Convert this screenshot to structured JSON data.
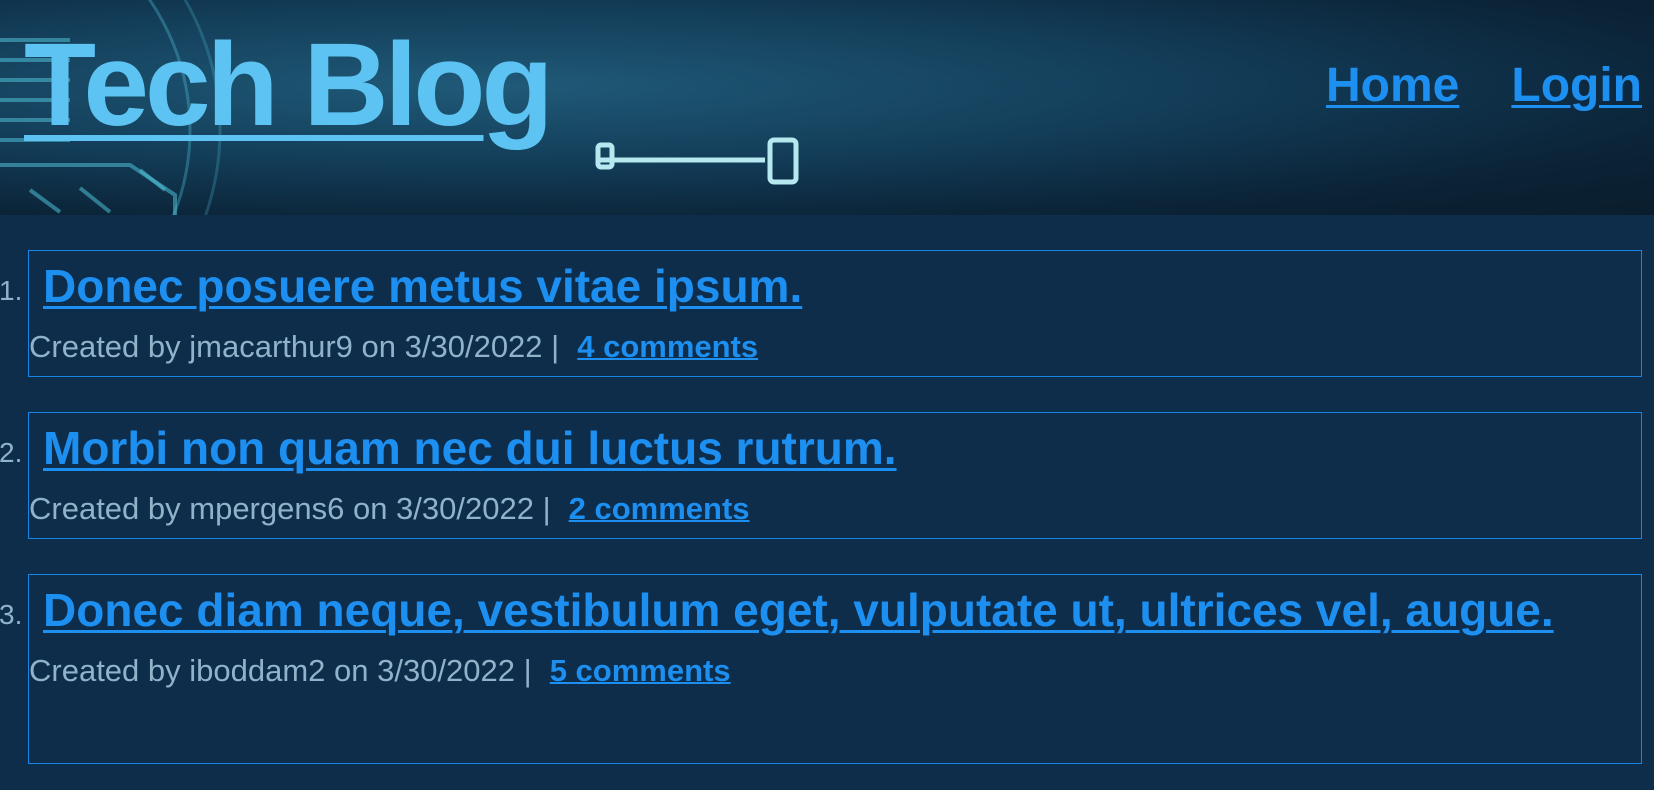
{
  "header": {
    "title": "Tech Blog",
    "nav": [
      {
        "label": "Home"
      },
      {
        "label": "Login"
      }
    ]
  },
  "posts": [
    {
      "number": "1.",
      "title": "Donec posuere metus vitae ipsum.",
      "meta": "Created by jmacarthur9 on 3/30/2022 |",
      "comments": "4 comments"
    },
    {
      "number": "2.",
      "title": "Morbi non quam nec dui luctus rutrum.",
      "meta": "Created by mpergens6 on 3/30/2022 |",
      "comments": "2 comments"
    },
    {
      "number": "3.",
      "title": "Donec diam neque, vestibulum eget, vulputate ut, ultrices vel, augue.",
      "meta": "Created by iboddam2 on 3/30/2022 |",
      "comments": "5 comments"
    }
  ],
  "colors": {
    "accent": "#1d8ff0",
    "title": "#5cc3f2",
    "background": "#0d2d4b",
    "meta_text": "#8fb3c8"
  }
}
